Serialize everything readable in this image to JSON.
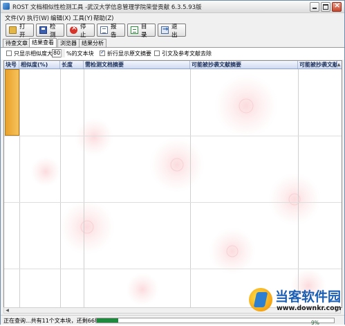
{
  "window": {
    "title": "ROST 文档相似性检测工具 -武汉大学信息管理学院荣誉贡献 6.3.5.93版"
  },
  "menu": [
    {
      "label": "文件(V)"
    },
    {
      "label": "执行(W)"
    },
    {
      "label": "编辑(X)"
    },
    {
      "label": "工具(Y)"
    },
    {
      "label": "帮助(Z)"
    }
  ],
  "toolbar": {
    "open": {
      "label": "打开",
      "icon": "folder-open-icon"
    },
    "detect": {
      "label": "检测",
      "icon": "save-disk-icon"
    },
    "stop": {
      "label": "停止",
      "icon": "stop-icon"
    },
    "report": {
      "label": "报告",
      "icon": "report-icon"
    },
    "dir": {
      "label": "目录",
      "icon": "directory-icon"
    },
    "exit": {
      "label": "退出",
      "icon": "exit-icon"
    }
  },
  "tabs": [
    {
      "label": "待查文章",
      "active": false
    },
    {
      "label": "结果查看",
      "active": true
    },
    {
      "label": "浏览器",
      "active": false
    },
    {
      "label": "结果分析",
      "active": false
    }
  ],
  "options": {
    "only_show_prefix": "只显示相似度大",
    "threshold": "80",
    "only_show_suffix": "%的文本块",
    "fold_label": "折行显示原文摘要",
    "fold_checked": true,
    "only_checked": false,
    "citation_label": "引文及参考文献去除",
    "citation_checked": false
  },
  "table": {
    "columns": [
      "块号",
      "相似度(%)",
      "长度",
      "需检测文档摘要",
      "可能被抄袭文献摘要",
      "可能被抄袭文献摘要"
    ]
  },
  "status": {
    "text": "正在查询...共有11个文本块，还剩66秒",
    "progress_percent": 9,
    "progress_label": "9%",
    "progress_color": "#1f8a3e"
  },
  "watermark": {
    "brand": "当客软件园",
    "url": "www.downkr.com"
  }
}
